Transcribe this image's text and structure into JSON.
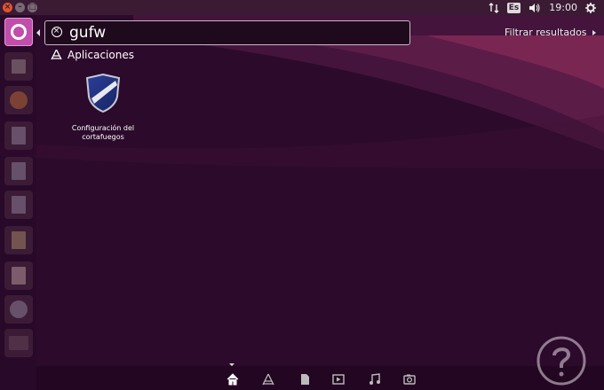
{
  "top_panel": {
    "keyboard_layout": "Es",
    "volume_icon": "volume-icon",
    "network_icon": "network-updown-icon",
    "clock": "19:00",
    "settings_icon": "gear-icon"
  },
  "window_controls": {
    "close_glyph": "×",
    "minimize_glyph": "–",
    "maximize_glyph": "□"
  },
  "launcher": {
    "items": [
      "ubuntu-dash-icon",
      "file-manager-icon",
      "firefox-icon",
      "writer-icon",
      "calc-icon",
      "impress-icon",
      "software-center-icon",
      "amazon-icon",
      "system-settings-icon",
      "terminal-icon"
    ]
  },
  "search": {
    "query": "gufw",
    "clear_icon": "clear-circle-icon"
  },
  "filter": {
    "label": "Filtrar resultados"
  },
  "results": {
    "category_label": "Aplicaciones",
    "category_icon": "applications-icon",
    "items": [
      {
        "label": "Configuración del cortafuegos",
        "icon": "shield-icon"
      }
    ]
  },
  "lenses": [
    "home-icon",
    "applications-icon",
    "files-icon",
    "video-icon",
    "music-icon",
    "photo-icon"
  ],
  "colors": {
    "background": "#2c0a2c",
    "dash_button": "#c04eaa",
    "close_button": "#e2542b"
  }
}
